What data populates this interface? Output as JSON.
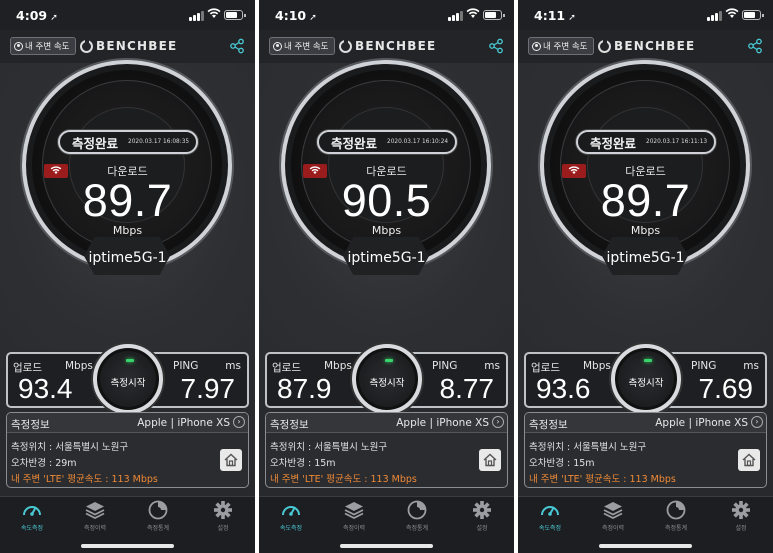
{
  "header": {
    "nearby_label": "내 주변 속도",
    "logo_text": "BENCHBEE"
  },
  "labels": {
    "download": "다운로드",
    "download_unit": "Mbps",
    "complete": "측정완료",
    "upload": "업로드",
    "upload_unit": "Mbps",
    "ping": "PING",
    "ping_unit": "ms",
    "start": "측정시작",
    "info_title": "측정정보",
    "device": "Apple | iPhone XS"
  },
  "tabs": [
    {
      "label": "속도측정",
      "icon": "speedometer-icon",
      "active": true
    },
    {
      "label": "측정이력",
      "icon": "layers-icon",
      "active": false
    },
    {
      "label": "측정통계",
      "icon": "chart-icon",
      "active": false
    },
    {
      "label": "설정",
      "icon": "gear-icon",
      "active": false
    }
  ],
  "colors": {
    "accent": "#48c9d4",
    "orange": "#ef8a36",
    "wifi_red": "#9b1c1c",
    "led_green": "#39d36b"
  },
  "screens": [
    {
      "time": "4:09",
      "timestamp": "2020.03.17 16:08:35",
      "download": "89.7",
      "ssid": "iptime5G-1",
      "upload": "93.4",
      "ping": "7.97",
      "location": "측정위치 : 서울특별시 노원구",
      "error_radius": "오차반경 : 29m",
      "avg_speed": "내 주변 'LTE' 평균속도 : 113 Mbps"
    },
    {
      "time": "4:10",
      "timestamp": "2020.03.17 16:10:24",
      "download": "90.5",
      "ssid": "iptime5G-1",
      "upload": "87.9",
      "ping": "8.77",
      "location": "측정위치 : 서울특별시 노원구",
      "error_radius": "오차반경 : 15m",
      "avg_speed": "내 주변 'LTE' 평균속도 : 113 Mbps"
    },
    {
      "time": "4:11",
      "timestamp": "2020.03.17 16:11:13",
      "download": "89.7",
      "ssid": "iptime5G-1",
      "upload": "93.6",
      "ping": "7.69",
      "location": "측정위치 : 서울특별시 노원구",
      "error_radius": "오차반경 : 15m",
      "avg_speed": "내 주변 'LTE' 평균속도 : 113 Mbps"
    }
  ]
}
